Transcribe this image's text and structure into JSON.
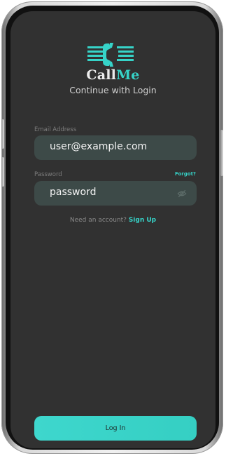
{
  "brand": {
    "name_part1": "Call",
    "name_part2": "Me",
    "accent_color": "#36d3c8"
  },
  "login": {
    "subtitle": "Continue with Login",
    "email_label": "Email Address",
    "email_value": "user@example.com",
    "password_label": "Password",
    "forgot_label": "Forgot?",
    "password_value": "password",
    "signup_prompt": "Need an account?",
    "signup_link": "Sign Up",
    "login_button": "Log In"
  },
  "icons": {
    "logo": "phone-receiver-logo-icon",
    "password_toggle": "eye-off-icon"
  }
}
